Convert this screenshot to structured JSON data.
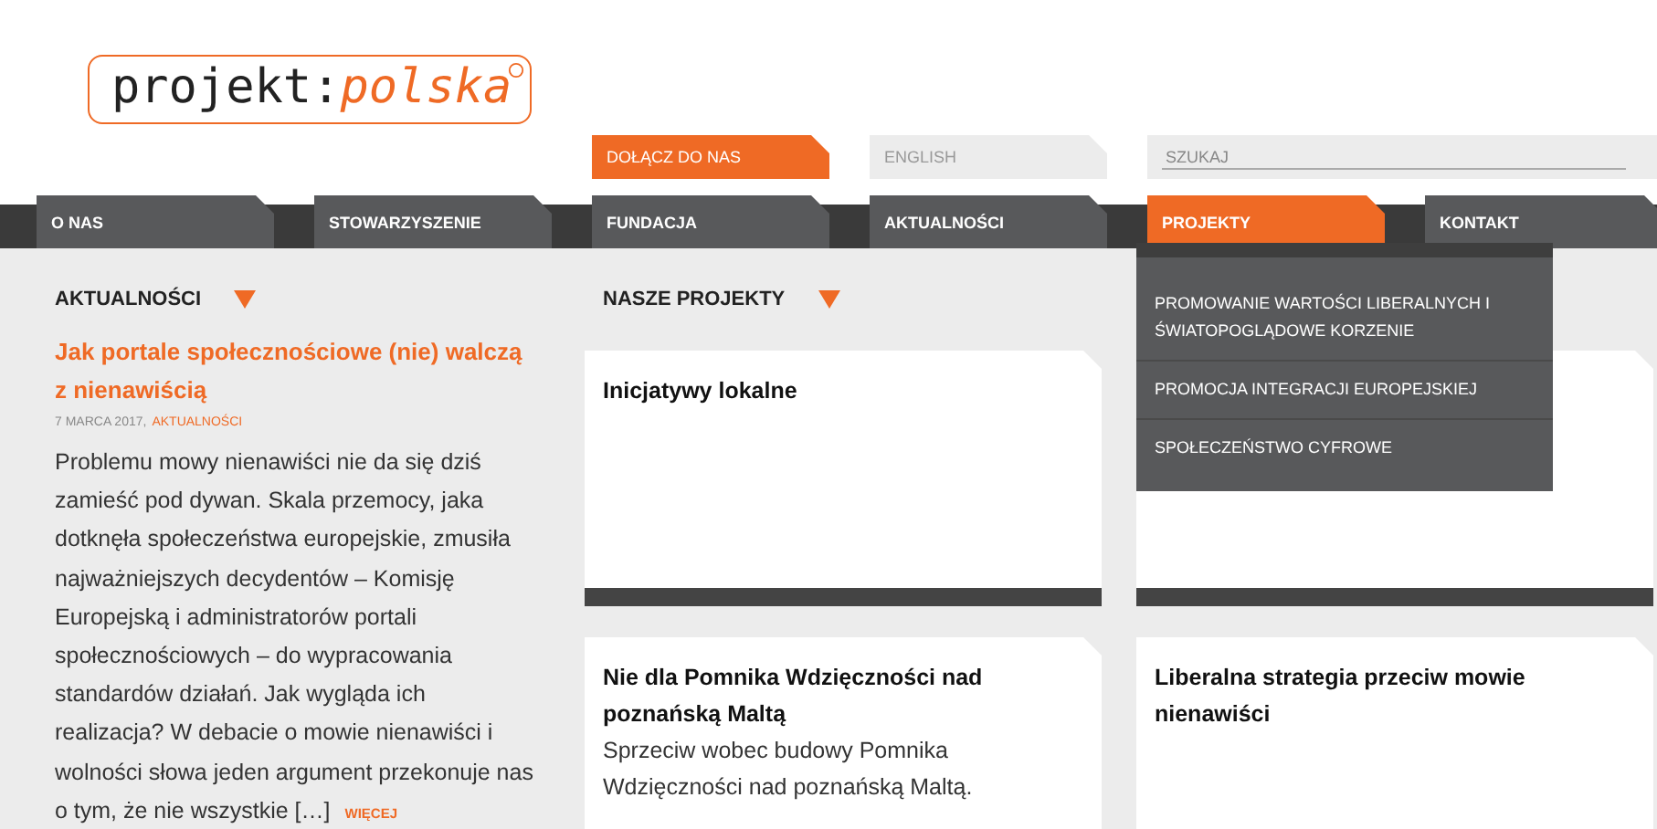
{
  "logo": {
    "text": "projekt:",
    "accent": "polska"
  },
  "top_links": [
    {
      "label": "DOŁĄCZ DO NAS",
      "kind": "accent"
    },
    {
      "label": "ENGLISH",
      "kind": "plain"
    }
  ],
  "search": {
    "placeholder": "SZUKAJ"
  },
  "nav": [
    {
      "label": "O NAS",
      "selected": false
    },
    {
      "label": "STOWARZYSZENIE",
      "selected": false
    },
    {
      "label": "FUNDACJA",
      "selected": false
    },
    {
      "label": "AKTUALNOŚCI",
      "selected": false
    },
    {
      "label": "PROJEKTY",
      "selected": true
    },
    {
      "label": "KONTAKT",
      "selected": false
    }
  ],
  "dropdown": [
    "PROMOWANIE WARTOŚCI LIBERALNYCH I ŚWIATOPOGLĄDOWE KORZENIE",
    "PROMOCJA INTEGRACJI EUROPEJSKIEJ",
    "SPOŁECZEŃSTWO CYFROWE"
  ],
  "news": {
    "heading": "AKTUALNOŚCI",
    "title": "Jak portale społecznościowe (nie) walczą z nienawiścią",
    "date": "7 MARCA 2017,",
    "category": "AKTUALNOŚCI",
    "body": "Problemu mowy nienawiści nie da się dziś zamieść pod dywan. Skala przemocy, jaka dotknęła społeczeństwa europejskie, zmusiła najważniejszych decydentów – Komisję Europejską i administratorów portali społecznościowych – do wypracowania standardów działań. Jak wygląda ich realizacja? W debacie o mowie nienawiści i wolności słowa jeden argument przekonuje nas o tym, że nie wszystkie […]",
    "more": "WIĘCEJ"
  },
  "projects": {
    "heading": "NASZE PROJEKTY",
    "cards": [
      {
        "title": "Inicjatywy lokalne",
        "footer_bar": true
      },
      {
        "footer_bar": true
      },
      {
        "title": "Nie dla Pomnika Wdzięczności nad poznańską Maltą",
        "text": "Sprzeciw wobec budowy Pomnika Wdzięczności nad poznańską Maltą."
      },
      {
        "title": "Liberalna strategia przeciw mowie nienawiści"
      }
    ]
  }
}
